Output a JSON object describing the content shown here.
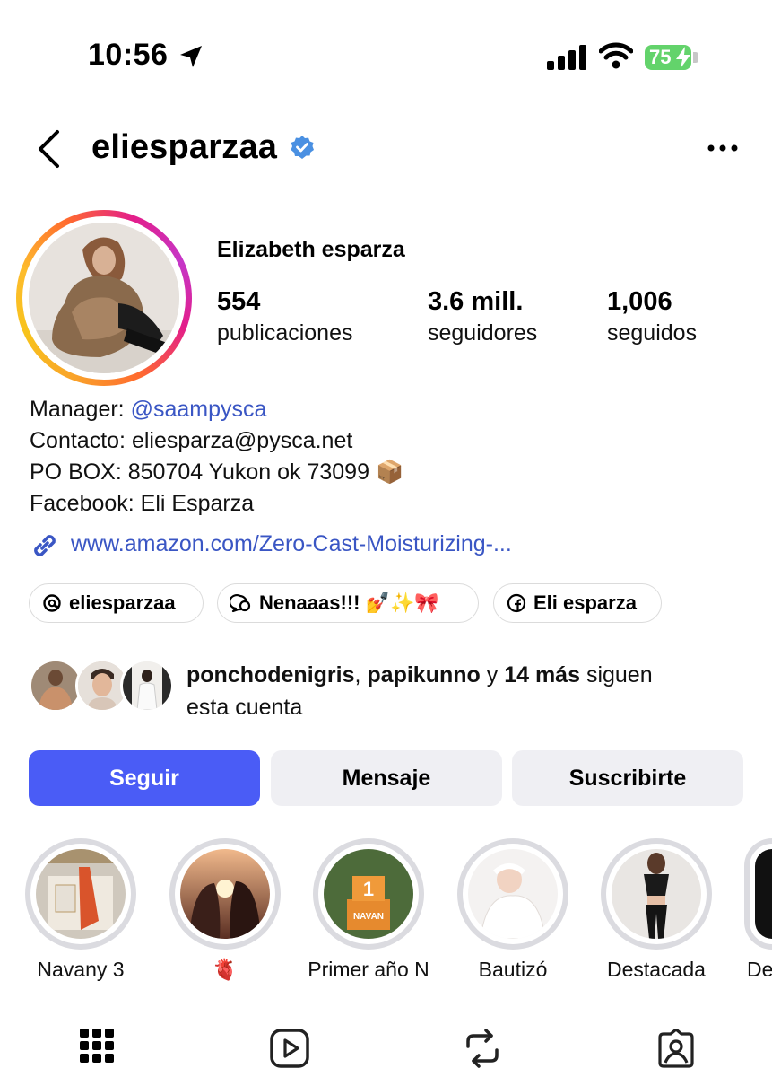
{
  "status_bar": {
    "time": "10:56",
    "battery": "75"
  },
  "header": {
    "username": "eliesparzaa",
    "verified": true
  },
  "profile": {
    "full_name": "Elizabeth esparza",
    "stats": [
      {
        "value": "554",
        "label": "publicaciones"
      },
      {
        "value": "3.6 mill.",
        "label": "seguidores"
      },
      {
        "value": "1,006",
        "label": "seguidos"
      }
    ]
  },
  "bio": {
    "manager_label": "Manager: ",
    "manager_handle": "@saampysca",
    "contact": "Contacto: eliesparza@pysca.net",
    "po_box": "PO BOX: 850704 Yukon ok 73099 📦",
    "facebook": "Facebook: Eli Esparza",
    "link": "www.amazon.com/Zero-Cast-Moisturizing-..."
  },
  "chips": [
    {
      "icon": "threads-icon",
      "label": "eliesparzaa"
    },
    {
      "icon": "message-bubble-icon",
      "label": "Nenaaas!!! 💅✨🎀"
    },
    {
      "icon": "facebook-icon",
      "label": "Eli esparza"
    }
  ],
  "mutual": {
    "user1": "ponchodenigris",
    "sep1": ", ",
    "user2": "papikunno",
    "sep2": " y ",
    "more": "14 más",
    "tail1": " siguen",
    "tail2": "esta cuenta"
  },
  "actions": {
    "follow": "Seguir",
    "message": "Mensaje",
    "subscribe": "Suscribirte"
  },
  "highlights": [
    {
      "label": "Navany 3"
    },
    {
      "label": "🫀"
    },
    {
      "label": "Primer año N"
    },
    {
      "label": "Bautizó"
    },
    {
      "label": "Destacada"
    },
    {
      "label": "De"
    }
  ],
  "colors": {
    "accent": "#4a5cf6",
    "link": "#3a56c4",
    "verified": "#4a90e2"
  }
}
